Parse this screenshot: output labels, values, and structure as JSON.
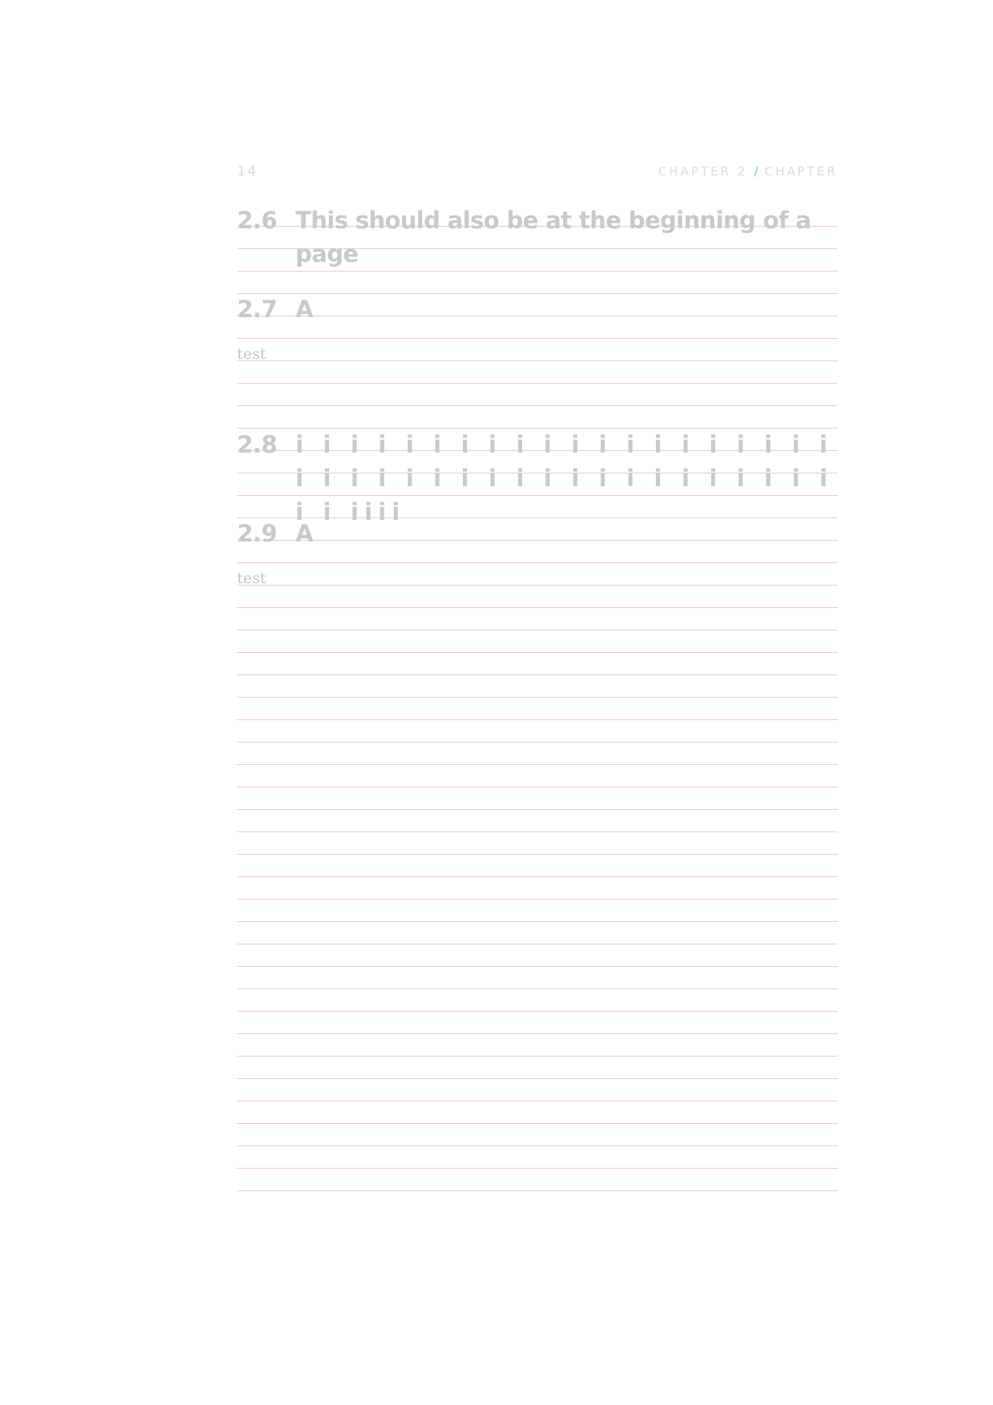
{
  "header": {
    "page_number": "14",
    "running_title_left": "CHAPTER 2",
    "separator": "/",
    "running_title_right": "CHAPTER"
  },
  "sections": [
    {
      "number": "2.6",
      "title": "This should also be at the beginning of a page"
    },
    {
      "number": "2.7",
      "title": "A",
      "body": "test"
    },
    {
      "number": "2.8",
      "title": "i i i i i i i i i i i i i i i i i i i i i i i i i i i i i i i i i i i i i i i i i i iiii"
    },
    {
      "number": "2.9",
      "title": "A",
      "body": "test"
    }
  ],
  "colors": {
    "heading_text": "#c9c9c9",
    "body_text": "#c4c4c4",
    "header_text": "#d9dce4",
    "separator_accent": "#8fd9c6",
    "grid_line": "#f2c6cd"
  }
}
